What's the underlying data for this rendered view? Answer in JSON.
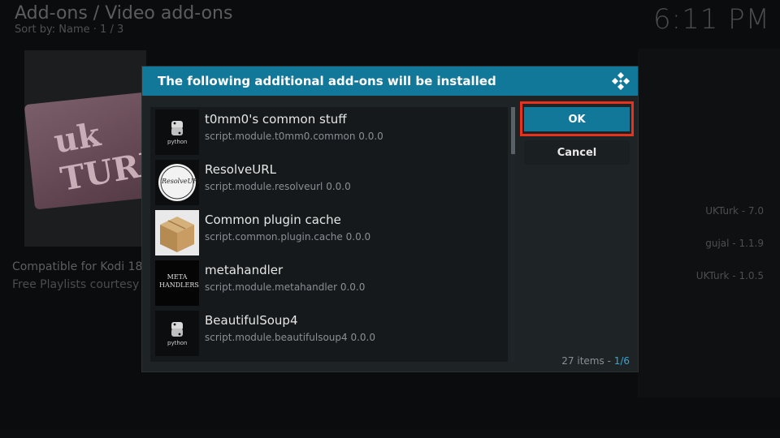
{
  "background": {
    "title": "Add-ons / Video add-ons",
    "sort": "Sort by: Name  ·  1 / 3",
    "clock": "6:11 PM",
    "art_text": "uk TURK",
    "description_line1": "Compatible for Kodi 18",
    "description_line2": "Free Playlists courtesy o",
    "right_list": [
      "UKTurk - 7.0",
      "gujal - 1.1.9",
      "UKTurk - 1.0.5"
    ]
  },
  "dialog": {
    "title": "The following additional add-ons will be installed",
    "items": [
      {
        "name": "t0mm0's common stuff",
        "id": "script.module.t0mm0.common 0.0.0",
        "icon": "python-icon",
        "icon_text": "python"
      },
      {
        "name": "ResolveURL",
        "id": "script.module.resolveurl 0.0.0",
        "icon": "resolveurl-logo-icon",
        "icon_text": "ResolveURL"
      },
      {
        "name": "Common plugin cache",
        "id": "script.common.plugin.cache 0.0.0",
        "icon": "cardboard-box-icon"
      },
      {
        "name": "metahandler",
        "id": "script.module.metahandler 0.0.0",
        "icon": "metahandler-logo-icon",
        "icon_text": "META HANDLERS"
      },
      {
        "name": "BeautifulSoup4",
        "id": "script.module.beautifulsoup4 0.0.0",
        "icon": "python-icon",
        "icon_text": "python"
      }
    ],
    "ok_label": "OK",
    "cancel_label": "Cancel",
    "count_prefix": "27 items - ",
    "count_page": "1/6"
  },
  "colors": {
    "accent": "#12789a",
    "highlight": "#e8321e",
    "dialog_bg": "#1e2326"
  }
}
